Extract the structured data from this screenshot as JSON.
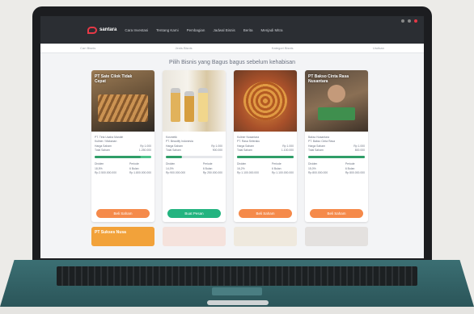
{
  "nav": {
    "brand": "santara",
    "items": [
      "Cara Investasi",
      "Tentang Kami",
      "Pembagian",
      "Jadwal Bisnis",
      "Berita",
      "Menjadi Mitra"
    ]
  },
  "filters": [
    "Cari Bisnis",
    "Jenis Bisnis",
    "Kategori Bisnis",
    "Urutkan"
  ],
  "headline": "Pilih Bisnis yang Bagus bagus sebelum kehabisan",
  "cards": [
    {
      "title": "PT Sate Cilok Tidak Cepat",
      "owner": "PT. Tirta Usaha Mandiri",
      "category": "Kuliner / Makanan",
      "price_label": "Harga Saham",
      "price": "Rp 1.000",
      "total_label": "Total Saham",
      "total": "1.250.000",
      "progress": 82,
      "stat_left_label": "Dividen",
      "stat_left": "18,5%",
      "stat_right_label": "Periode",
      "stat_right": "6 Bulan",
      "stat_left2": "Rp 2.500.000.000",
      "stat_right2": "Rp 1.800.000.000",
      "cta": "Beli Saham",
      "cta_color": "orange"
    },
    {
      "title": "",
      "owner": "Kosmetik",
      "category": "PT. Beautify Indonesia",
      "price_label": "Harga Saham",
      "price": "Rp 1.000",
      "total_label": "Total Saham",
      "total": "900.000",
      "progress": 28,
      "stat_left_label": "Dividen",
      "stat_left": "14,0%",
      "stat_right_label": "Periode",
      "stat_right": "6 Bulan",
      "stat_left2": "Rp 900.000.000",
      "stat_right2": "Rp 250.000.000",
      "cta": "Buat Pesan",
      "cta_color": "green"
    },
    {
      "title": "",
      "owner": "Kuliner Nusantara",
      "category": "PT. Rasa Seleraku",
      "price_label": "Harga Saham",
      "price": "Rp 1.000",
      "total_label": "Total Saham",
      "total": "1.100.000",
      "progress": 100,
      "stat_left_label": "Dividen",
      "stat_left": "16,2%",
      "stat_right_label": "Periode",
      "stat_right": "6 Bulan",
      "stat_left2": "Rp 1.100.000.000",
      "stat_right2": "Rp 1.100.000.000",
      "cta": "Beli Saham",
      "cta_color": "orange"
    },
    {
      "title": "PT Bakso Cinta Rasa Nusantara",
      "owner": "Bakso Nusantara",
      "category": "PT. Bakso Cinta Rasa",
      "price_label": "Harga Saham",
      "price": "Rp 1.000",
      "total_label": "Total Saham",
      "total": "800.000",
      "progress": 100,
      "stat_left_label": "Dividen",
      "stat_left": "15,0%",
      "stat_right_label": "Periode",
      "stat_right": "6 Bulan",
      "stat_left2": "Rp 800.000.000",
      "stat_right2": "Rp 800.000.000",
      "cta": "Beli Saham",
      "cta_color": "orange"
    }
  ],
  "row2": [
    "PT Sukses Nusa",
    "",
    "",
    ""
  ]
}
